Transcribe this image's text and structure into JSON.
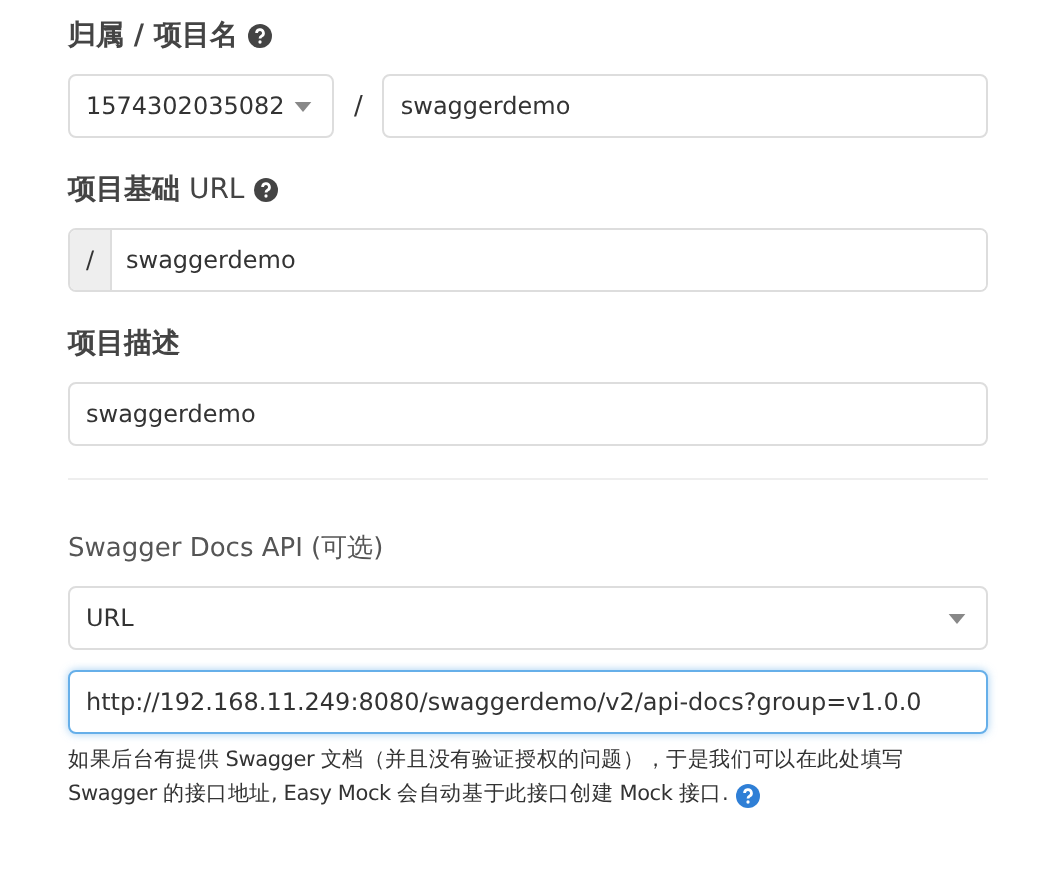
{
  "owner_field": {
    "label": "归属 / 项目名",
    "select_value": "1574302035082",
    "separator": "/",
    "name_value": "swaggerdemo"
  },
  "base_url_field": {
    "label": "**项目基础** URL",
    "prefix": "/",
    "value": "swaggerdemo"
  },
  "description_field": {
    "label": "项目描述",
    "value": "swaggerdemo"
  },
  "swagger_section": {
    "label": "Swagger Docs API (可选)",
    "source_select": "URL",
    "url_input": {
      "value": "http://192.168.11.249:8080/swaggerdemo/v2/api-docs?group=v1.0.0",
      "focused": true
    },
    "hint_lines": [
      "如果后台有提供 Swagger 文档（并且没有验证授权的问题），于是我们可以在此处填写",
      "Swagger 的接口地址, Easy Mock 会自动基于此接口创建 Mock 接口."
    ]
  }
}
